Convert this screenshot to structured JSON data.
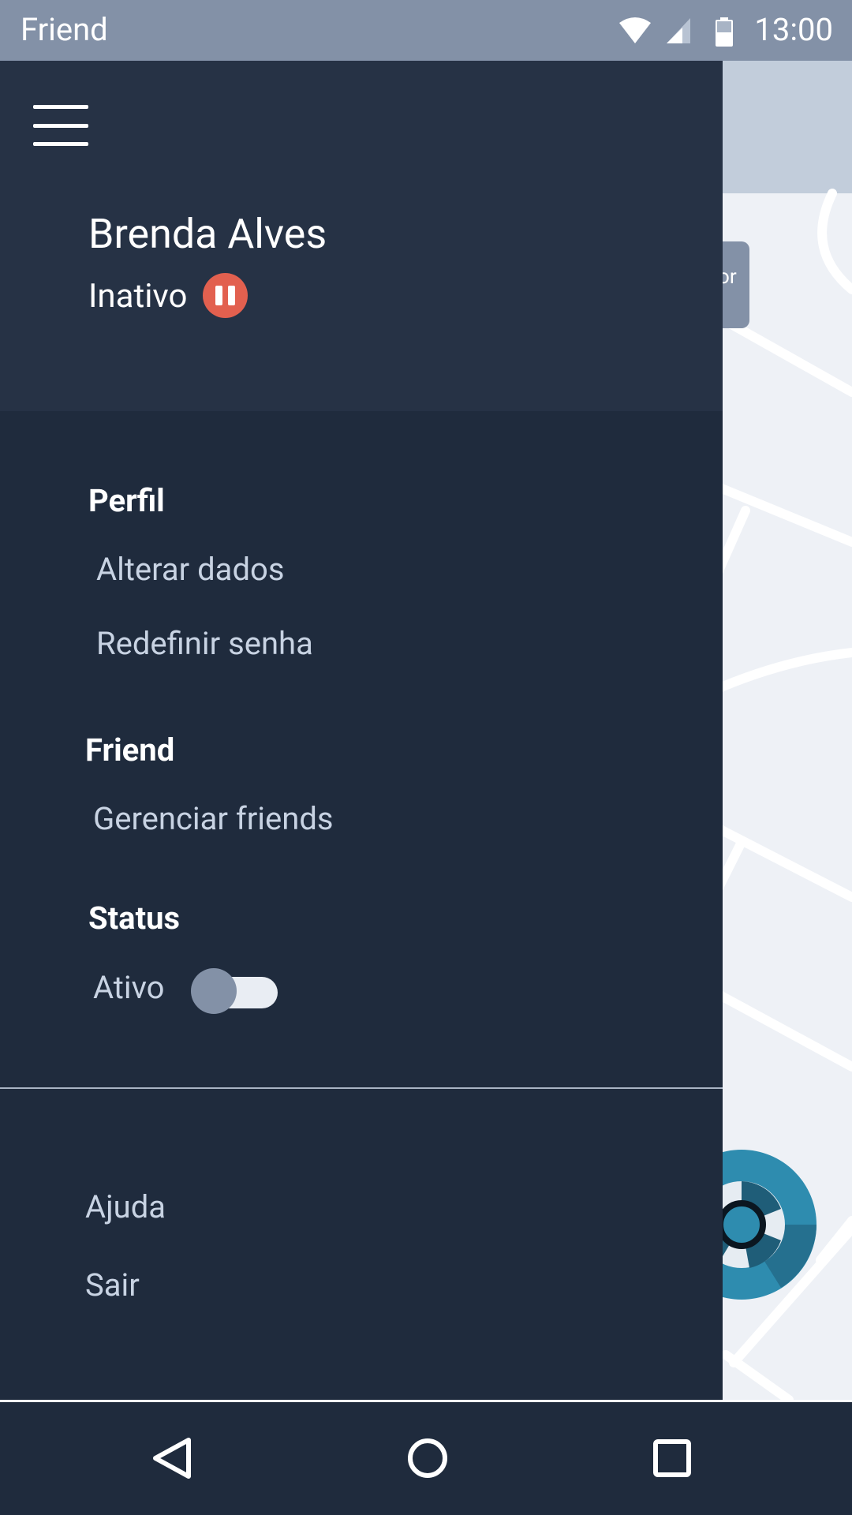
{
  "status_bar": {
    "app_label": "Friend",
    "time": "13:00",
    "icons": [
      "wifi-icon",
      "cell-signal-icon",
      "battery-icon"
    ]
  },
  "map": {
    "chip_text": "or"
  },
  "drawer": {
    "user_name": "Brenda Alves",
    "user_status": "Inativo",
    "status_badge_icon": "pause-icon",
    "sections": {
      "profile": {
        "title": "Perfil",
        "items": [
          "Alterar dados",
          "Redefinir senha"
        ]
      },
      "friend": {
        "title": "Friend",
        "items": [
          "Gerenciar friends"
        ]
      },
      "status": {
        "title": "Status",
        "toggle_label": "Ativo",
        "toggle_on": false
      }
    },
    "footer_items": [
      "Ajuda",
      "Sair"
    ]
  },
  "colors": {
    "status_bar": "#8391a7",
    "drawer_bg": "#1f2b3d",
    "drawer_header": "#263245",
    "pause_badge": "#e2604f",
    "map_marker": "#2e8caf"
  },
  "nav_bar": {
    "buttons": [
      "back-icon",
      "home-icon",
      "recents-icon"
    ]
  }
}
